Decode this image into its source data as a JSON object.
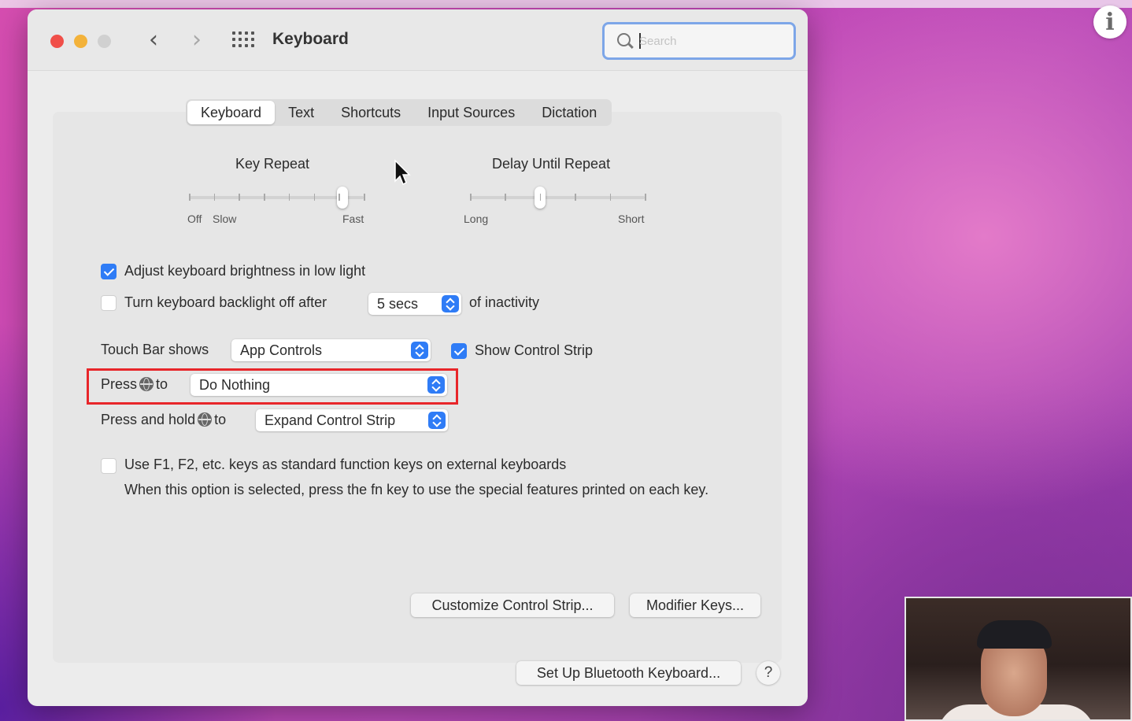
{
  "window": {
    "title": "Keyboard"
  },
  "search": {
    "placeholder": "Search"
  },
  "tabs": [
    {
      "label": "Keyboard",
      "active": true
    },
    {
      "label": "Text",
      "active": false
    },
    {
      "label": "Shortcuts",
      "active": false
    },
    {
      "label": "Input Sources",
      "active": false
    },
    {
      "label": "Dictation",
      "active": false
    }
  ],
  "key_repeat": {
    "label": "Key Repeat",
    "min_labels": [
      "Off",
      "Slow"
    ],
    "max_label": "Fast",
    "value_fraction": 0.88
  },
  "delay_until_repeat": {
    "label": "Delay Until Repeat",
    "min_label": "Long",
    "max_label": "Short",
    "value_fraction": 0.4
  },
  "brightness": {
    "label": "Adjust keyboard brightness in low light",
    "checked": true
  },
  "backlight": {
    "label": "Turn keyboard backlight off after",
    "checked": false,
    "value": "5 secs",
    "suffix": "of inactivity"
  },
  "touch_bar": {
    "label": "Touch Bar shows",
    "value": "App Controls",
    "show_strip_label": "Show Control Strip",
    "show_strip_checked": true
  },
  "press_globe": {
    "prefix": "Press",
    "suffix": "to",
    "value": "Do Nothing"
  },
  "press_hold_globe": {
    "prefix": "Press and hold",
    "suffix": "to",
    "value": "Expand Control Strip"
  },
  "fn_keys": {
    "label": "Use F1, F2, etc. keys as standard function keys on external keyboards",
    "description": "When this option is selected, press the fn key to use the special features printed on each key.",
    "checked": false
  },
  "buttons": {
    "customize": "Customize Control Strip...",
    "modifier": "Modifier Keys...",
    "bluetooth": "Set Up Bluetooth Keyboard...",
    "help": "?"
  },
  "overlay": {
    "info": "i"
  },
  "colors": {
    "accent": "#2f7cf6",
    "highlight": "#e8262a"
  }
}
